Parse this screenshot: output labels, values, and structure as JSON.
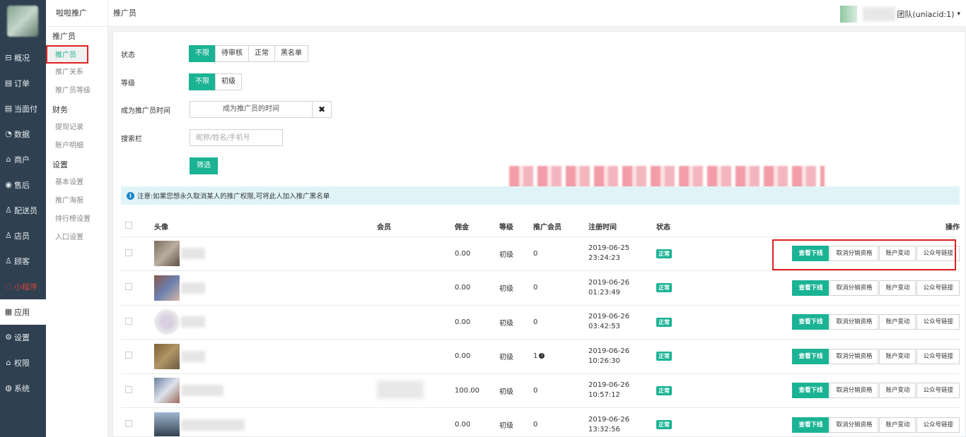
{
  "nav1": {
    "items": [
      {
        "icon": "⊟",
        "label": "概况",
        "icon_name": "overview-icon"
      },
      {
        "icon": "▤",
        "label": "订单",
        "icon_name": "order-icon"
      },
      {
        "icon": "▤",
        "label": "当面付",
        "icon_name": "pay-icon"
      },
      {
        "icon": "◔",
        "label": "数据",
        "icon_name": "data-icon"
      },
      {
        "icon": "⌂",
        "label": "商户",
        "icon_name": "shop-icon"
      },
      {
        "icon": "◉",
        "label": "售后",
        "icon_name": "aftersale-icon"
      },
      {
        "icon": "♙",
        "label": "配送员",
        "icon_name": "courier-icon"
      },
      {
        "icon": "♙",
        "label": "店员",
        "icon_name": "clerk-icon"
      },
      {
        "icon": "♙",
        "label": "顾客",
        "icon_name": "customer-icon"
      },
      {
        "icon": "◌",
        "label": "小程序",
        "icon_name": "miniprogram-icon"
      },
      {
        "icon": "▦",
        "label": "应用",
        "icon_name": "apps-icon"
      },
      {
        "icon": "⚙",
        "label": "设置",
        "icon_name": "gear-icon"
      },
      {
        "icon": "⌂",
        "label": "权限",
        "icon_name": "lock-icon"
      },
      {
        "icon": "◍",
        "label": "系统",
        "icon_name": "system-icon"
      }
    ]
  },
  "nav2": {
    "title": "啦啦推广",
    "g1": "推广员",
    "l1": "推广员",
    "l2": "推广关系",
    "l3": "推广员等级",
    "g2": "财务",
    "l4": "提现记录",
    "l5": "账户明细",
    "g3": "设置",
    "l6": "基本设置",
    "l7": "推广海报",
    "l8": "排行榜设置",
    "l9": "入口设置"
  },
  "header": {
    "page_title": "推广员",
    "user_suffix": "团队(uniacid:1)",
    "caret": "▾"
  },
  "filters": {
    "status_label": "状态",
    "status_opts": [
      "不限",
      "待审核",
      "正常",
      "黑名单"
    ],
    "level_label": "等级",
    "level_opts": [
      "不限",
      "初级"
    ],
    "time_label": "成为推广员时间",
    "time_value": "成为推广员的时间",
    "time_clear": "✖",
    "search_label": "搜索栏",
    "search_placeholder": "昵称/姓名/手机号",
    "filter_btn": "筛选"
  },
  "notice": {
    "icon": "i",
    "text": "注意:如果您想永久取消某人的推广权限,可将此人加入推广黑名单"
  },
  "table": {
    "headers": {
      "avatar": "头像",
      "member": "会员",
      "commission": "佣金",
      "level": "等级",
      "invited": "推广会员",
      "reg_time": "注册时间",
      "status": "状态",
      "ops": "操作"
    },
    "op_labels": {
      "sub": "查看下线",
      "cancel": "取消分销资格",
      "account": "账户变动",
      "link": "公众号链接"
    },
    "rows": [
      {
        "commission": "0.00",
        "level": "初级",
        "invited": "0",
        "date": "2019-06-25",
        "time": "23:24:23",
        "status": "正常"
      },
      {
        "commission": "0.00",
        "level": "初级",
        "invited": "0",
        "date": "2019-06-26",
        "time": "01:23:49",
        "status": "正常"
      },
      {
        "commission": "0.00",
        "level": "初级",
        "invited": "0",
        "date": "2019-06-26",
        "time": "03:42:53",
        "status": "正常"
      },
      {
        "commission": "0.00",
        "level": "初级",
        "invited": "1",
        "date": "2019-06-26",
        "time": "10:26:30",
        "status": "正常"
      },
      {
        "commission": "100.00",
        "level": "初级",
        "invited": "0",
        "date": "2019-06-26",
        "time": "10:57:12",
        "status": "正常"
      },
      {
        "commission": "0.00",
        "level": "初级",
        "invited": "0",
        "date": "2019-06-26",
        "time": "13:32:56",
        "status": "正常"
      }
    ]
  }
}
